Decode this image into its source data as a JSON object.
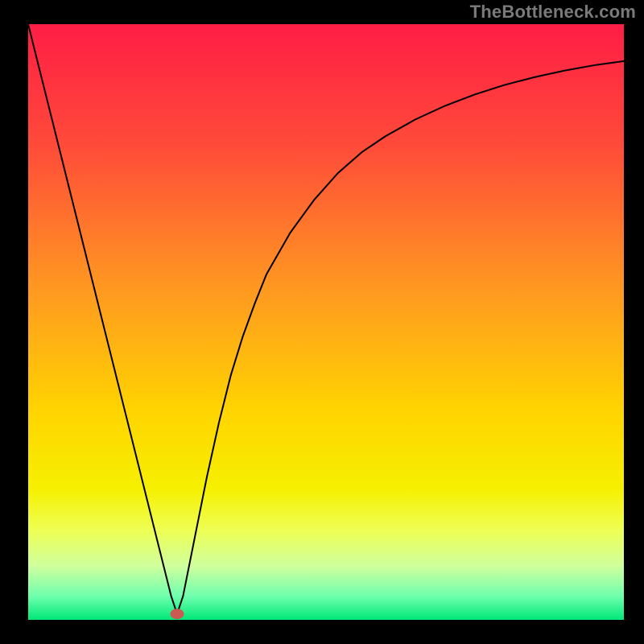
{
  "watermark": "TheBottleneck.com",
  "colors": {
    "gradient_stops": [
      {
        "offset": 0,
        "color": "#ff1d45"
      },
      {
        "offset": 20,
        "color": "#ff4a3a"
      },
      {
        "offset": 45,
        "color": "#ff9a20"
      },
      {
        "offset": 65,
        "color": "#ffd400"
      },
      {
        "offset": 78,
        "color": "#f6f000"
      },
      {
        "offset": 85,
        "color": "#eeff55"
      },
      {
        "offset": 91,
        "color": "#cfff9e"
      },
      {
        "offset": 96,
        "color": "#6fffad"
      },
      {
        "offset": 100,
        "color": "#00e878"
      }
    ],
    "curve": "#000000",
    "marker": "#c95b52",
    "background": "#000000"
  },
  "chart_data": {
    "type": "line",
    "title": "",
    "xlabel": "",
    "ylabel": "",
    "xlim": [
      0,
      100
    ],
    "ylim": [
      0,
      100
    ],
    "grid": false,
    "x": [
      0,
      2,
      4,
      6,
      8,
      10,
      12,
      14,
      16,
      18,
      20,
      22,
      24,
      25,
      26,
      28,
      30,
      32,
      34,
      36,
      38,
      40,
      44,
      48,
      52,
      56,
      60,
      65,
      70,
      75,
      80,
      85,
      90,
      95,
      100
    ],
    "values": [
      100,
      92,
      84,
      76,
      68,
      60,
      52,
      44,
      36,
      28,
      20,
      12,
      4,
      1,
      4,
      14,
      24,
      33,
      41,
      47.5,
      53,
      58,
      65,
      70.5,
      75,
      78.5,
      81.2,
      84,
      86.3,
      88.2,
      89.8,
      91.1,
      92.2,
      93.1,
      93.8
    ],
    "marker": {
      "x": 25,
      "y": 1
    }
  }
}
